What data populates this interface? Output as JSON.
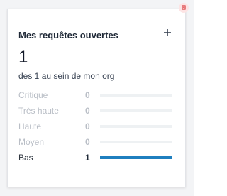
{
  "widget": {
    "title": "Mes requêtes ouvertes",
    "add_label": "+",
    "open_count": "1",
    "subtitle": "des 1 au sein de mon org",
    "accent_color": "#1f7fbf",
    "corner_icon": "alert-badge-icon",
    "add_icon": "plus-icon"
  },
  "priorities": [
    {
      "label": "Critique",
      "count": "0",
      "fraction": 0
    },
    {
      "label": "Très haute",
      "count": "0",
      "fraction": 0
    },
    {
      "label": "Haute",
      "count": "0",
      "fraction": 0
    },
    {
      "label": "Moyen",
      "count": "0",
      "fraction": 0
    },
    {
      "label": "Bas",
      "count": "1",
      "fraction": 1
    }
  ]
}
